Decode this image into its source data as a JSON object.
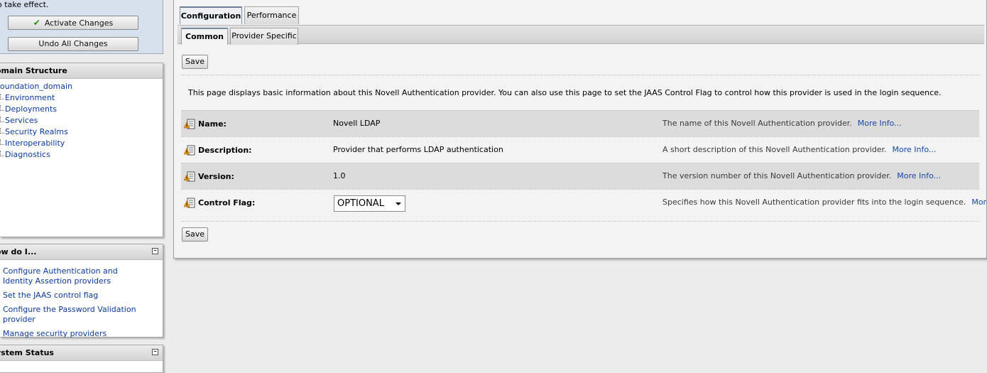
{
  "change_center": {
    "take_effect_text": "o take effect.",
    "activate_label": "Activate Changes",
    "undo_label": "Undo All Changes"
  },
  "domain_structure": {
    "title": "omain Structure",
    "root": "foundation_domain",
    "items": [
      "Environment",
      "Deployments",
      "Services",
      "Security Realms",
      "Interoperability",
      "Diagnostics"
    ]
  },
  "how_do_i": {
    "title": "ow do I...",
    "links": [
      "Configure Authentication and Identity Assertion providers",
      "Set the JAAS control flag",
      "Configure the Password Validation provider",
      "Manage security providers"
    ]
  },
  "system_status": {
    "title": "ystem Status"
  },
  "main": {
    "tabs": [
      {
        "label": "Configuration",
        "active": true
      },
      {
        "label": "Performance",
        "active": false
      }
    ],
    "subtabs": [
      {
        "label": "Common",
        "active": true
      },
      {
        "label": "Provider Specific",
        "active": false
      }
    ],
    "save_label": "Save",
    "intro": "This page displays basic information about this Novell Authentication provider. You can also use this page to set the JAAS Control Flag to control how this provider is used in the login sequence.",
    "properties": [
      {
        "label": "Name:",
        "value": "Novell LDAP",
        "help": "The name of this Novell Authentication provider.",
        "more": "More Info..."
      },
      {
        "label": "Description:",
        "value": "Provider that performs LDAP authentication",
        "help": "A short description of this Novell Authentication provider.",
        "more": "More Info..."
      },
      {
        "label": "Version:",
        "value": "1.0",
        "help": "The version number of this Novell Authentication provider.",
        "more": "More Info..."
      },
      {
        "label": "Control Flag:",
        "value": "OPTIONAL",
        "help": "Specifies how this Novell Authentication provider fits into the login sequence.",
        "more": "More Info..."
      }
    ]
  }
}
